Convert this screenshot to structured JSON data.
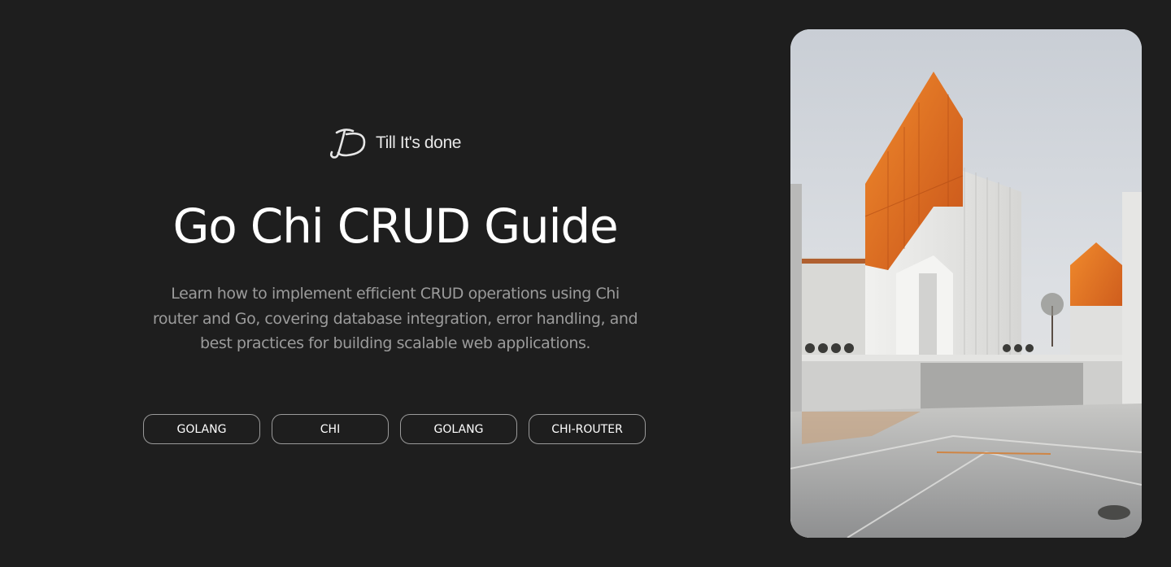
{
  "brand": {
    "name": "Till It's done",
    "logo_icon": "td-monogram-icon"
  },
  "article": {
    "title": "Go Chi CRUD Guide",
    "description": "Learn how to implement efficient CRUD operations using Chi router and Go, covering database integration, error handling, and best practices for building scalable web applications."
  },
  "tags": [
    "GOLANG",
    "CHI",
    "GOLANG",
    "CHI-ROUTER"
  ],
  "hero_image": {
    "subject": "modern-architecture-orange-panels"
  },
  "colors": {
    "background": "#1e1e1e",
    "title": "#ffffff",
    "description": "#9b9b9b",
    "tag_border": "#9a9a9a",
    "accent_orange": "#e0661c"
  }
}
